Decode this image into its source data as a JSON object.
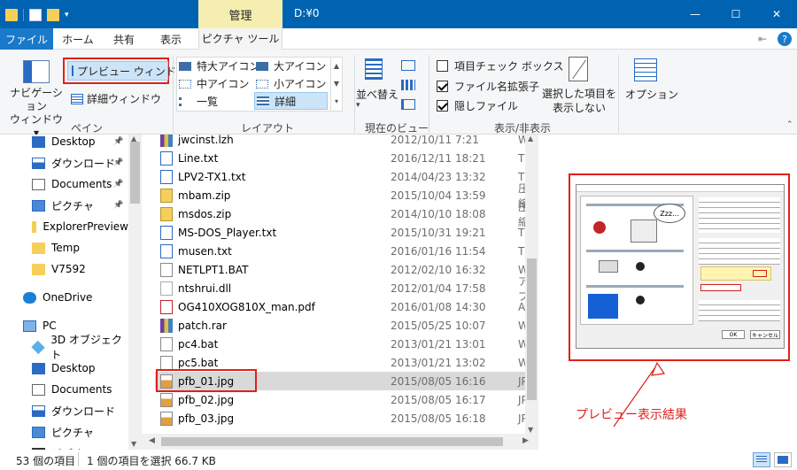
{
  "titlebar": {
    "context_tab": "管理",
    "path": "D:¥0",
    "min_glyph": "—",
    "max_glyph": "☐",
    "close_glyph": "✕"
  },
  "tabs": {
    "file": "ファイル",
    "home": "ホーム",
    "share": "共有",
    "view": "表示",
    "picture_tools": "ピクチャ ツール"
  },
  "ribbon": {
    "pane": {
      "nav_pane": "ナビゲーション\nウィンドウ ▾",
      "preview_pane": "プレビュー ウィンドウ",
      "details_pane": "詳細ウィンドウ",
      "label": "ペイン"
    },
    "layout": {
      "extra_large": "特大アイコン",
      "large": "大アイコン",
      "medium": "中アイコン",
      "small": "小アイコン",
      "list": "一覧",
      "details": "詳細",
      "label": "レイアウト"
    },
    "current_view": {
      "sort_by": "並べ替え",
      "label": "現在のビュー"
    },
    "show_hide": {
      "item_checkboxes": "項目チェック ボックス",
      "item_checkboxes_checked": false,
      "file_extensions": "ファイル名拡張子",
      "file_extensions_checked": true,
      "hidden_items": "隠しファイル",
      "hidden_items_checked": true,
      "hide_selected": "選択した項目を\n表示しない",
      "label": "表示/非表示"
    },
    "options": "オプション"
  },
  "nav": {
    "items": [
      {
        "label": "Desktop",
        "icon": "desktop-icon",
        "pinned": true
      },
      {
        "label": "ダウンロード",
        "icon": "download-icon",
        "pinned": true
      },
      {
        "label": "Documents",
        "icon": "documents-icon",
        "pinned": true
      },
      {
        "label": "ピクチャ",
        "icon": "pictures-icon",
        "pinned": true
      },
      {
        "label": "ExplorerPreview",
        "icon": "folder-icon",
        "pinned": false
      },
      {
        "label": "Temp",
        "icon": "folder-icon",
        "pinned": false
      },
      {
        "label": "V7592",
        "icon": "folder-icon",
        "pinned": false
      },
      {
        "label": "OneDrive",
        "icon": "cloud-icon",
        "pinned": false
      },
      {
        "label": "PC",
        "icon": "pc-icon",
        "pinned": false
      },
      {
        "label": "3D オブジェクト",
        "icon": "3d-objects-icon",
        "pinned": false
      },
      {
        "label": "Desktop",
        "icon": "desktop-icon",
        "pinned": false
      },
      {
        "label": "Documents",
        "icon": "documents-icon",
        "pinned": false
      },
      {
        "label": "ダウンロード",
        "icon": "download-icon",
        "pinned": false
      },
      {
        "label": "ピクチャ",
        "icon": "pictures-icon",
        "pinned": false
      },
      {
        "label": "ビデオ",
        "icon": "video-icon",
        "pinned": false
      }
    ]
  },
  "files": [
    {
      "name": "jwcinst.lzh",
      "date": "2012/10/11 7:21",
      "type": "Wir",
      "icon": "archive-icon"
    },
    {
      "name": "Line.txt",
      "date": "2016/12/11 18:21",
      "type": "TXT",
      "icon": "text-file-icon"
    },
    {
      "name": "LPV2-TX1.txt",
      "date": "2014/04/23 13:32",
      "type": "TXT",
      "icon": "text-file-icon"
    },
    {
      "name": "mbam.zip",
      "date": "2015/10/04 13:59",
      "type": "圧縮",
      "icon": "zip-icon"
    },
    {
      "name": "msdos.zip",
      "date": "2014/10/10 18:08",
      "type": "圧縮",
      "icon": "zip-icon"
    },
    {
      "name": "MS-DOS_Player.txt",
      "date": "2015/10/31 19:21",
      "type": "TXT",
      "icon": "text-file-icon"
    },
    {
      "name": "musen.txt",
      "date": "2016/01/16 11:54",
      "type": "TXT",
      "icon": "text-file-icon"
    },
    {
      "name": "NETLPT1.BAT",
      "date": "2012/02/10 16:32",
      "type": "Wir",
      "icon": "batch-file-icon"
    },
    {
      "name": "ntshrui.dll",
      "date": "2012/01/04 17:58",
      "type": "アプ",
      "icon": "dll-file-icon"
    },
    {
      "name": "OG410XOG810X_man.pdf",
      "date": "2016/01/08 14:30",
      "type": "Ado",
      "icon": "pdf-file-icon"
    },
    {
      "name": "patch.rar",
      "date": "2015/05/25 10:07",
      "type": "Wir",
      "icon": "archive-icon"
    },
    {
      "name": "pc4.bat",
      "date": "2013/01/21 13:01",
      "type": "Wir",
      "icon": "batch-file-icon"
    },
    {
      "name": "pc5.bat",
      "date": "2013/01/21 13:02",
      "type": "Wir",
      "icon": "batch-file-icon"
    },
    {
      "name": "pfb_01.jpg",
      "date": "2015/08/05 16:16",
      "type": "JPG",
      "icon": "image-file-icon",
      "selected": true
    },
    {
      "name": "pfb_02.jpg",
      "date": "2015/08/05 16:17",
      "type": "JPG",
      "icon": "image-file-icon"
    },
    {
      "name": "pfb_03.jpg",
      "date": "2015/08/05 16:18",
      "type": "JPG",
      "icon": "image-file-icon"
    }
  ],
  "preview": {
    "annotation": "プレビュー表示結果",
    "image_caption_1": "Zzz...",
    "ok_button": "OK",
    "cancel_button": "キャンセル"
  },
  "status": {
    "item_count": "53 個の項目",
    "selection": "1 個の項目を選択 66.7 KB"
  }
}
